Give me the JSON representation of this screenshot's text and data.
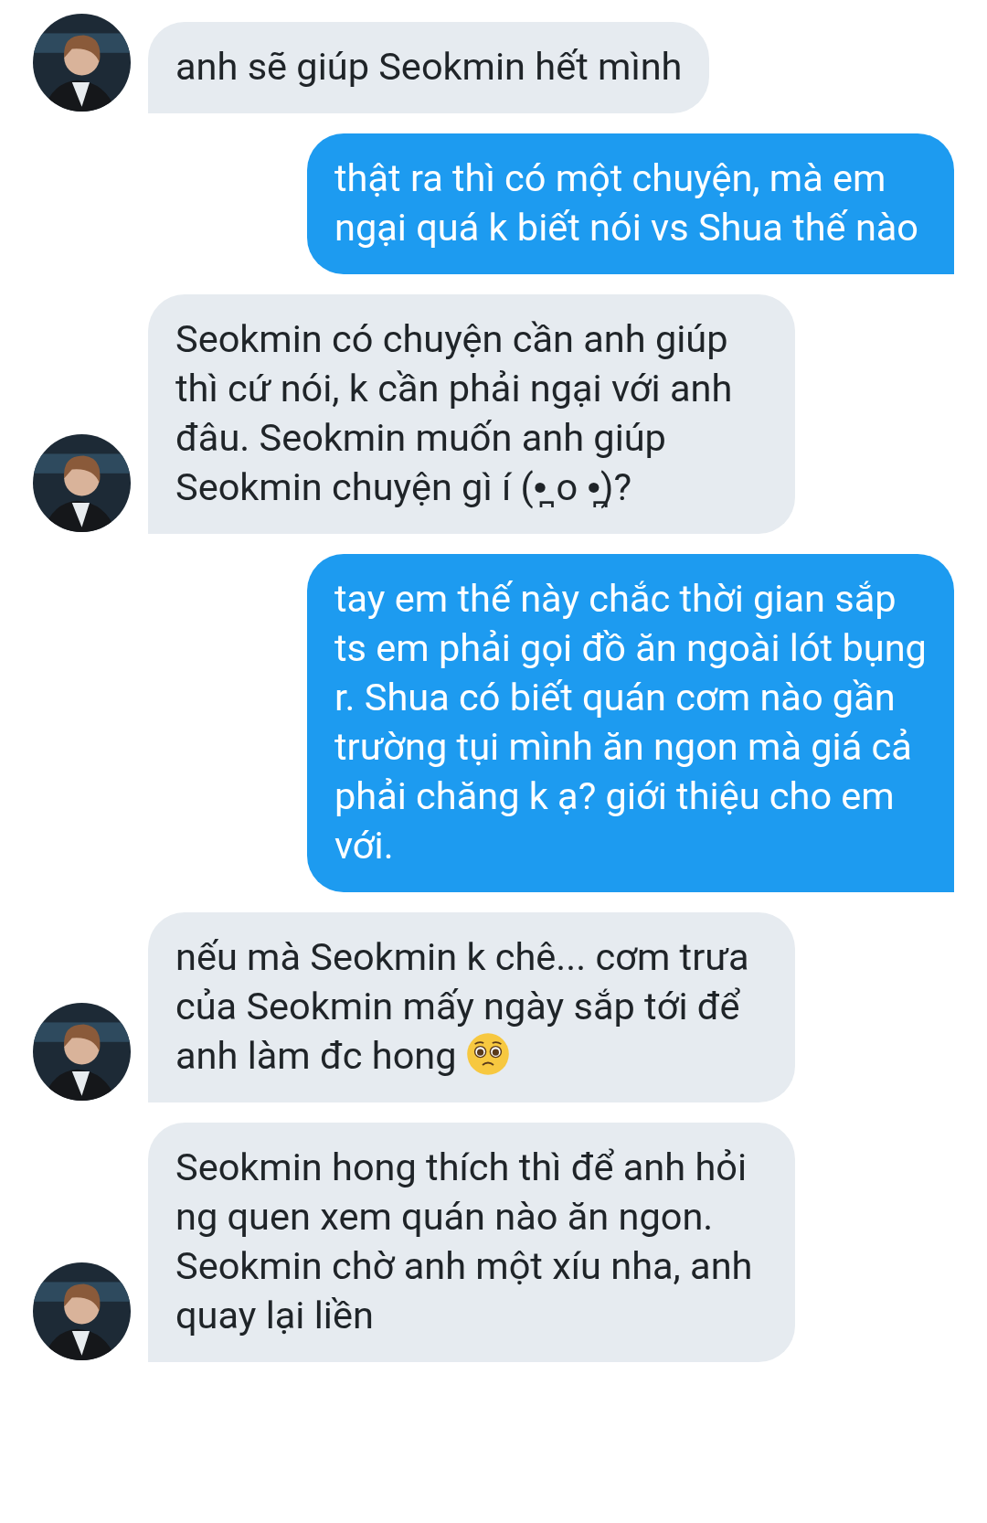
{
  "messages": [
    {
      "kind": "received",
      "text": "anh sẽ giúp Seokmin hết mình"
    },
    {
      "kind": "sent",
      "text": "thật ra thì có một chuyện, mà em ngại quá k biết nói vs Shua thế nào"
    },
    {
      "kind": "received",
      "text": "Seokmin có chuyện cần anh giúp thì cứ nói, k cần phải ngại với anh đâu. Seokmin muốn anh giúp Seokmin chuyện gì í (•̪ o •̪)?"
    },
    {
      "kind": "sent",
      "text": "tay em thế này chắc thời gian sắp ts em phải gọi đồ ăn ngoài lót bụng r. Shua có biết quán cơm nào gần trường tụi mình ăn ngon mà giá cả phải chăng k ạ? giới thiệu cho em với."
    },
    {
      "kind": "received",
      "text": "nếu mà Seokmin k chê... cơm trưa của Seokmin mấy ngày sắp tới để anh làm đc hong",
      "emoji": true
    },
    {
      "kind": "received",
      "text": "Seokmin hong thích thì để anh hỏi ng quen xem quán nào ăn ngon. Seokmin chờ anh một xíu nha, anh quay lại liền"
    }
  ]
}
